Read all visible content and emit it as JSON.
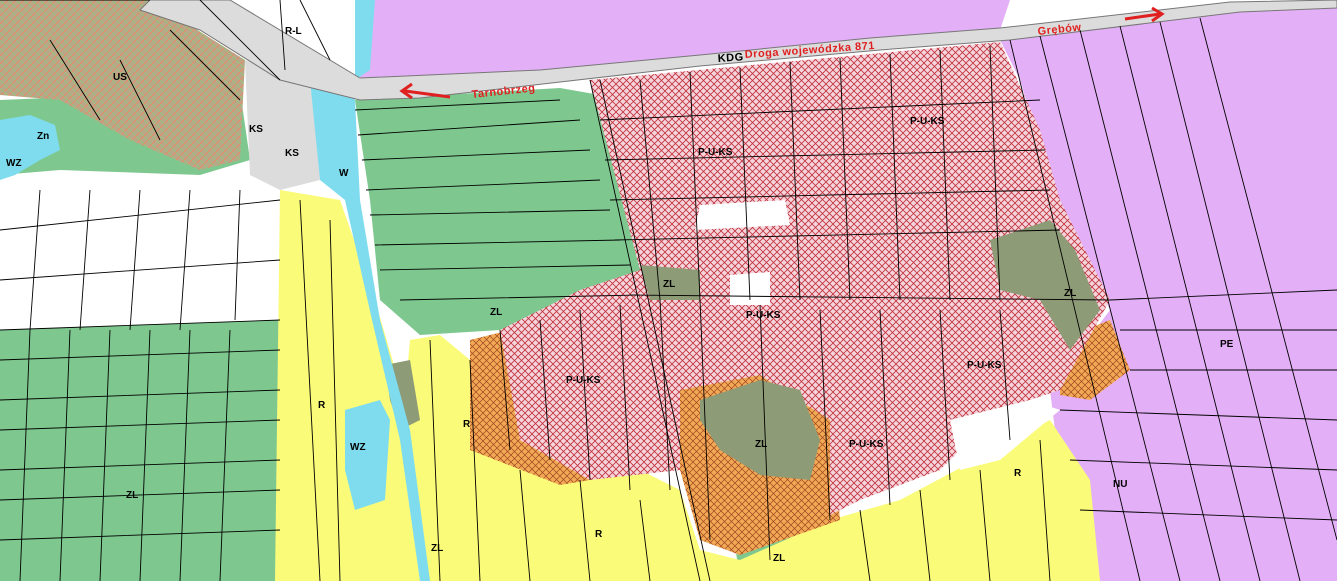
{
  "map": {
    "colors": {
      "residential_yellow": "#fbfb7a",
      "green_zl": "#7ec88f",
      "purple_industrial": "#e3b0f7",
      "water_blue": "#7fdcef",
      "hatch_red": "#c0303a",
      "hatch_fill": "#f6d4dc",
      "orange_hatch": "#f2a955",
      "forest_dark": "#8e9b77",
      "us_hatch_bg": "#b7a88a",
      "road_gray": "#dcdcdc",
      "arrow_red": "#e02020"
    },
    "road": {
      "name": "Droga wojewódzka  871",
      "code": "KDG",
      "left_direction": "Tarnobrzeg",
      "right_direction": "Grębów"
    },
    "zone_labels": [
      {
        "id": "r-l",
        "text": "R-L"
      },
      {
        "id": "us",
        "text": "US"
      },
      {
        "id": "zn",
        "text": "Zn"
      },
      {
        "id": "wz-left",
        "text": "WZ"
      },
      {
        "id": "ks-1",
        "text": "KS"
      },
      {
        "id": "ks-2",
        "text": "KS"
      },
      {
        "id": "w",
        "text": "W"
      },
      {
        "id": "pu-ks-top-left",
        "text": "P-U-KS"
      },
      {
        "id": "pu-ks-top-right",
        "text": "P-U-KS"
      },
      {
        "id": "zl-center",
        "text": "ZL"
      },
      {
        "id": "zl-right",
        "text": "ZL"
      },
      {
        "id": "pu-ks-center",
        "text": "P-U-KS"
      },
      {
        "id": "zl-mid-left",
        "text": "ZL"
      },
      {
        "id": "pu-ks-left",
        "text": "P-U-KS"
      },
      {
        "id": "pe",
        "text": "PE"
      },
      {
        "id": "pu-ks-right",
        "text": "P-U-KS"
      },
      {
        "id": "r-left",
        "text": "R"
      },
      {
        "id": "r-center",
        "text": "R"
      },
      {
        "id": "wz-center",
        "text": "WZ"
      },
      {
        "id": "zl-forest",
        "text": "ZL"
      },
      {
        "id": "pu-ks-bottom",
        "text": "P-U-KS"
      },
      {
        "id": "r-right",
        "text": "R"
      },
      {
        "id": "nu",
        "text": "NU"
      },
      {
        "id": "zl-bottom-left",
        "text": "ZL"
      },
      {
        "id": "zl-bottom-center",
        "text": "ZL"
      },
      {
        "id": "r-bottom",
        "text": "R"
      },
      {
        "id": "zl-bottom",
        "text": "ZL"
      }
    ]
  }
}
